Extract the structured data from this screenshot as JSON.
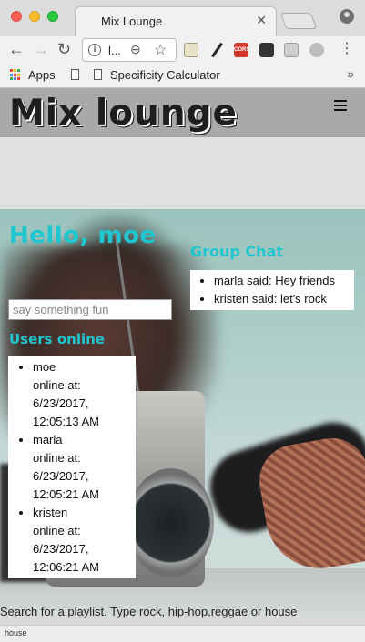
{
  "browser": {
    "tab_title": "Mix Lounge",
    "tab_close": "✕",
    "url_text": "l...",
    "nav_back": "←",
    "nav_forward": "→",
    "nav_reload": "↻",
    "omni_info": "i",
    "omni_zoom": "⊖",
    "omni_star": "☆",
    "ext_cors": "CORS",
    "menu": "⋮",
    "bookmarks": {
      "apps_label": "Apps",
      "item_label": "Specificity Calculator",
      "more": "»"
    },
    "apps_colors": [
      "#e94235",
      "#fbbc04",
      "#34a853",
      "#4285f4",
      "#e94235",
      "#fbbc04",
      "#34a853",
      "#4285f4",
      "#e94235"
    ]
  },
  "header": {
    "logo": "Mix lounge"
  },
  "hero": {
    "greeting": "Hello, moe",
    "chat": {
      "heading": "Group Chat",
      "messages": [
        "marla said: Hey friends",
        "kristen said: let's rock"
      ]
    },
    "message_input": {
      "placeholder": "say something fun",
      "value": ""
    },
    "users": {
      "heading": "Users online",
      "list": [
        {
          "name": "moe",
          "status_lines": [
            "online at:",
            "6/23/2017,",
            "12:05:13 AM"
          ]
        },
        {
          "name": "marla",
          "status_lines": [
            "online at:",
            "6/23/2017,",
            "12:05:21 AM"
          ]
        },
        {
          "name": "kristen",
          "status_lines": [
            "online at:",
            "6/23/2017,",
            "12:06:21 AM"
          ]
        }
      ]
    },
    "search_hint": "Search for a playlist. Type rock, hip-hop,reggae or house"
  },
  "status_bar": {
    "text": "house"
  },
  "colors": {
    "accent": "#1ec6cf",
    "header_bg": "#a9a9a9",
    "band_bg": "#e1e1e1"
  }
}
